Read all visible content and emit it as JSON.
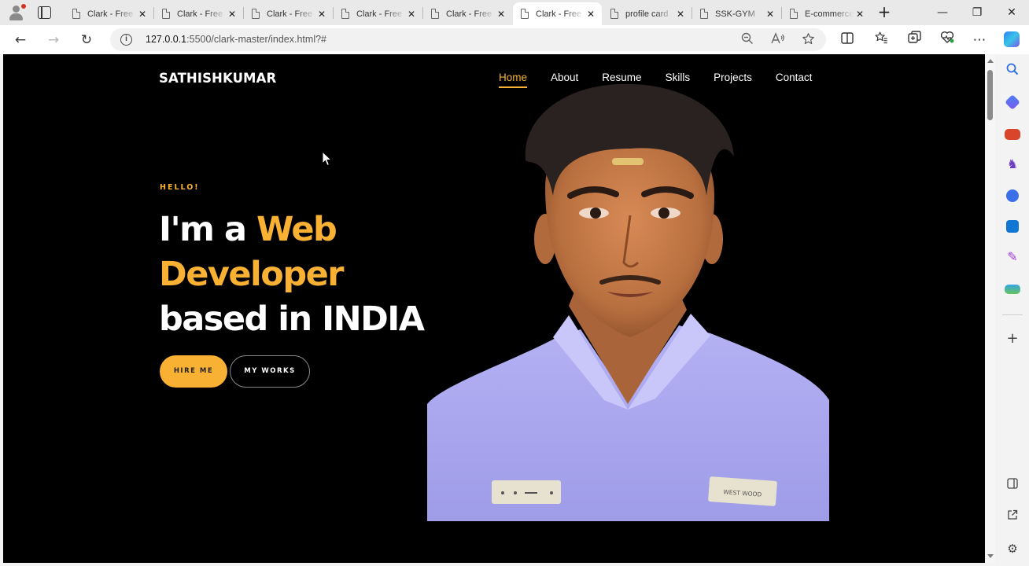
{
  "browser": {
    "tabs": [
      {
        "title": "Clark - Free Bootstrap",
        "active": false
      },
      {
        "title": "Clark - Free Bootstrap",
        "active": false
      },
      {
        "title": "Clark - Free Bootstrap",
        "active": false
      },
      {
        "title": "Clark - Free Bootstrap",
        "active": false
      },
      {
        "title": "Clark - Free Bootstrap",
        "active": false
      },
      {
        "title": "Clark - Free Bootstrap",
        "active": true
      },
      {
        "title": "profile card",
        "active": false
      },
      {
        "title": "SSK-GYM",
        "active": false
      },
      {
        "title": "E-commerce",
        "active": false
      }
    ],
    "close_glyph": "✕",
    "new_tab_glyph": "+",
    "window_controls": {
      "minimize": "—",
      "restore": "❐",
      "close": "✕"
    },
    "url_host": "127.0.0.1",
    "url_rest": ":5500/clark-master/index.html?#",
    "nav_glyphs": {
      "back": "←",
      "forward": "→",
      "refresh": "↻"
    }
  },
  "site": {
    "brand": "SATHISHKUMAR",
    "nav": [
      {
        "label": "Home",
        "active": true
      },
      {
        "label": "About",
        "active": false
      },
      {
        "label": "Resume",
        "active": false
      },
      {
        "label": "Skills",
        "active": false
      },
      {
        "label": "Projects",
        "active": false
      },
      {
        "label": "Contact",
        "active": false
      }
    ],
    "hero": {
      "greeting": "HELLO!",
      "line1_prefix": "I'm a ",
      "line1_highlight": "Web",
      "line2_highlight": "Developer",
      "line3": "based in INDIA",
      "cta_primary": "HIRE ME",
      "cta_secondary": "MY WORKS",
      "shirt_logo_text": "WEST WOOD"
    }
  },
  "colors": {
    "accent": "#f8b133",
    "page_bg": "#000000",
    "shirt": "#a9a7ee"
  }
}
